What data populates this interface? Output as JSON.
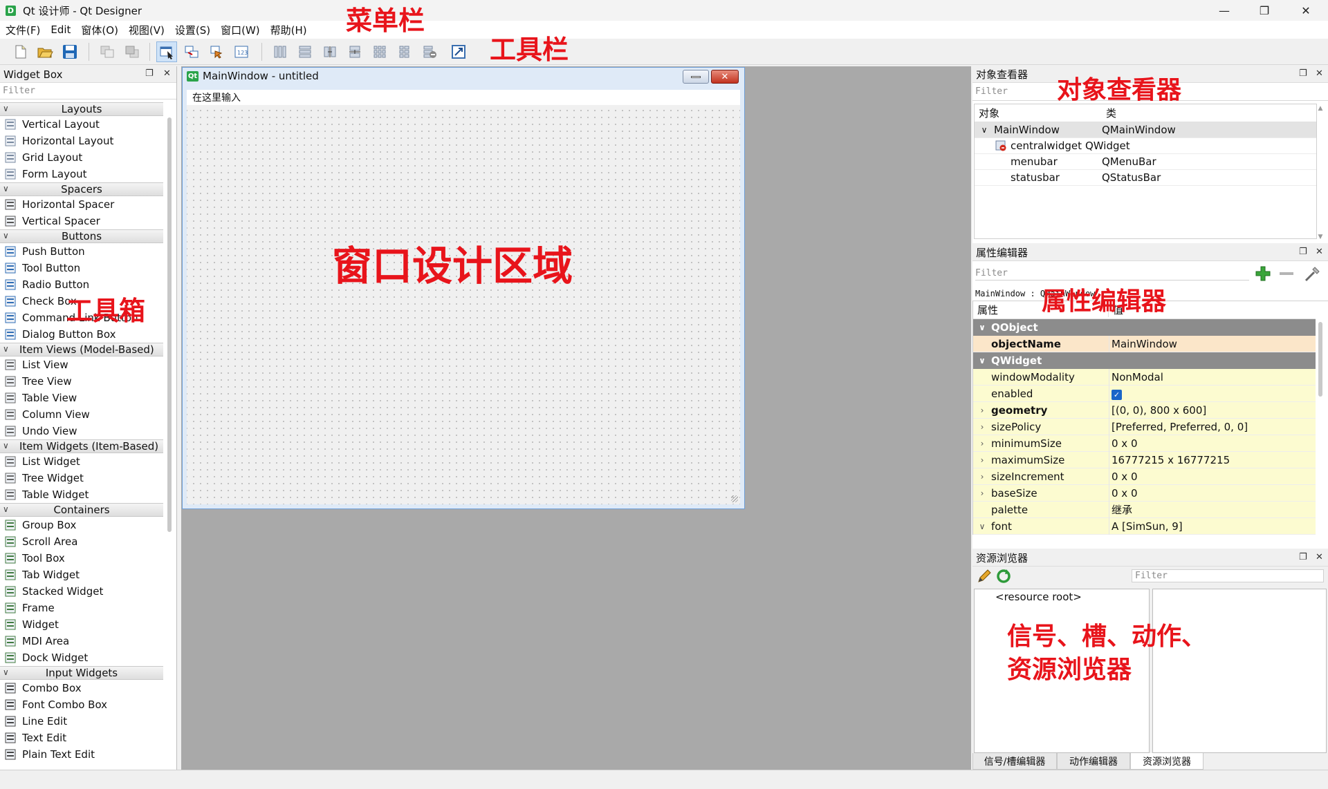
{
  "window": {
    "title": "Qt 设计师 - Qt Designer",
    "icon_letter": "D",
    "controls": [
      "minimize-icon",
      "maximize-icon",
      "close-icon"
    ]
  },
  "menubar": {
    "items": [
      "文件(F)",
      "Edit",
      "窗体(O)",
      "视图(V)",
      "设置(S)",
      "窗口(W)",
      "帮助(H)"
    ]
  },
  "toolbar": {
    "icons": [
      "new-form-icon",
      "open-form-icon",
      "save-form-icon",
      "send-to-back-icon",
      "bring-to-front-icon",
      "edit-widgets-icon",
      "edit-signals-slots-icon",
      "edit-buddies-icon",
      "edit-tab-order-icon",
      "lay-out-horizontally-icon",
      "lay-out-vertically-icon",
      "lay-out-horizontal-splitter-icon",
      "lay-out-vertical-splitter-icon",
      "lay-out-grid-icon",
      "lay-out-form-icon",
      "break-layout-icon",
      "adjust-size-icon"
    ]
  },
  "annotations": {
    "menubar": "菜单栏",
    "toolbar": "工具栏",
    "toolbox": "工具箱",
    "design_area": "窗口设计区域",
    "object_inspector": "对象查看器",
    "property_editor": "属性编辑器",
    "resource_line1": "信号、槽、动作、",
    "resource_line2": "资源浏览器"
  },
  "widget_box": {
    "title": "Widget Box",
    "filter_placeholder": "Filter",
    "categories": [
      {
        "name": "Layouts",
        "items": [
          "Vertical Layout",
          "Horizontal Layout",
          "Grid Layout",
          "Form Layout"
        ]
      },
      {
        "name": "Spacers",
        "items": [
          "Horizontal Spacer",
          "Vertical Spacer"
        ]
      },
      {
        "name": "Buttons",
        "items": [
          "Push Button",
          "Tool Button",
          "Radio Button",
          "Check Box",
          "Command Link Button",
          "Dialog Button Box"
        ]
      },
      {
        "name": "Item Views (Model-Based)",
        "items": [
          "List View",
          "Tree View",
          "Table View",
          "Column View",
          "Undo View"
        ]
      },
      {
        "name": "Item Widgets (Item-Based)",
        "items": [
          "List Widget",
          "Tree Widget",
          "Table Widget"
        ]
      },
      {
        "name": "Containers",
        "items": [
          "Group Box",
          "Scroll Area",
          "Tool Box",
          "Tab Widget",
          "Stacked Widget",
          "Frame",
          "Widget",
          "MDI Area",
          "Dock Widget"
        ]
      },
      {
        "name": "Input Widgets",
        "items": [
          "Combo Box",
          "Font Combo Box",
          "Line Edit",
          "Text Edit",
          "Plain Text Edit"
        ]
      }
    ]
  },
  "form_window": {
    "title": "MainWindow - untitled",
    "qt_badge": "Qt",
    "menubar_placeholder": "在这里输入"
  },
  "object_inspector": {
    "title": "对象查看器",
    "filter_placeholder": "Filter",
    "col_object": "对象",
    "col_class": "类",
    "rows": [
      {
        "object": "MainWindow",
        "class": "QMainWindow"
      },
      {
        "object": "centralwidget",
        "class": "QWidget"
      },
      {
        "object": "menubar",
        "class": "QMenuBar"
      },
      {
        "object": "statusbar",
        "class": "QStatusBar"
      }
    ]
  },
  "property_editor": {
    "title": "属性编辑器",
    "filter_placeholder": "Filter",
    "object_line": "MainWindow : QMainWindow",
    "col_property": "属性",
    "col_value": "值",
    "groups": [
      {
        "name": "QObject",
        "rows": [
          {
            "name": "objectName",
            "value": "MainWindow",
            "bold": true
          }
        ]
      },
      {
        "name": "QWidget",
        "rows": [
          {
            "name": "windowModality",
            "value": "NonModal"
          },
          {
            "name": "enabled",
            "value": "",
            "checkbox": true
          },
          {
            "name": "geometry",
            "value": "[(0, 0), 800 x 600]",
            "bold": true,
            "expand": true
          },
          {
            "name": "sizePolicy",
            "value": "[Preferred, Preferred, 0, 0]",
            "expand": true
          },
          {
            "name": "minimumSize",
            "value": "0 x 0",
            "expand": true
          },
          {
            "name": "maximumSize",
            "value": "16777215 x 16777215",
            "expand": true
          },
          {
            "name": "sizeIncrement",
            "value": "0 x 0",
            "expand": true
          },
          {
            "name": "baseSize",
            "value": "0 x 0",
            "expand": true
          },
          {
            "name": "palette",
            "value": "继承"
          },
          {
            "name": "font",
            "value": "A  [SimSun, 9]",
            "expanded": true
          }
        ]
      }
    ]
  },
  "resource_browser": {
    "title": "资源浏览器",
    "filter_placeholder": "Filter",
    "root": "<resource root>",
    "tabs": [
      "信号/槽编辑器",
      "动作编辑器",
      "资源浏览器"
    ],
    "active_tab": 2
  },
  "colors": {
    "annotation": "#e8141b",
    "mdi_background": "#a9a9a9",
    "property_row": "#fcfbd0",
    "property_group": "#8c8c8c",
    "qt_green": "#2aa34a"
  }
}
